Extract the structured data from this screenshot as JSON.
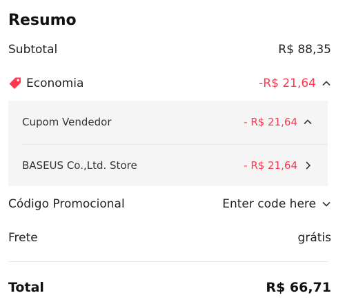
{
  "summary": {
    "title": "Resumo",
    "subtotal": {
      "label": "Subtotal",
      "value": "R$ 88,35"
    },
    "savings": {
      "label": "Economia",
      "value": "-R$ 21,64",
      "icon": "tag-icon",
      "items": [
        {
          "label": "Cupom Vendedor",
          "value": "- R$ 21,64",
          "icon": "chevron-up-icon"
        },
        {
          "label": "BASEUS Co.,Ltd. Store",
          "value": "- R$ 21,64",
          "icon": "chevron-right-icon"
        }
      ]
    },
    "promo": {
      "label": "Código Promocional",
      "value": "Enter code here",
      "icon": "chevron-down-icon"
    },
    "shipping": {
      "label": "Frete",
      "value": "grátis"
    },
    "total": {
      "label": "Total",
      "value": "R$ 66,71"
    },
    "colors": {
      "accent": "#fd384f",
      "panel": "#f5f5f5"
    }
  }
}
